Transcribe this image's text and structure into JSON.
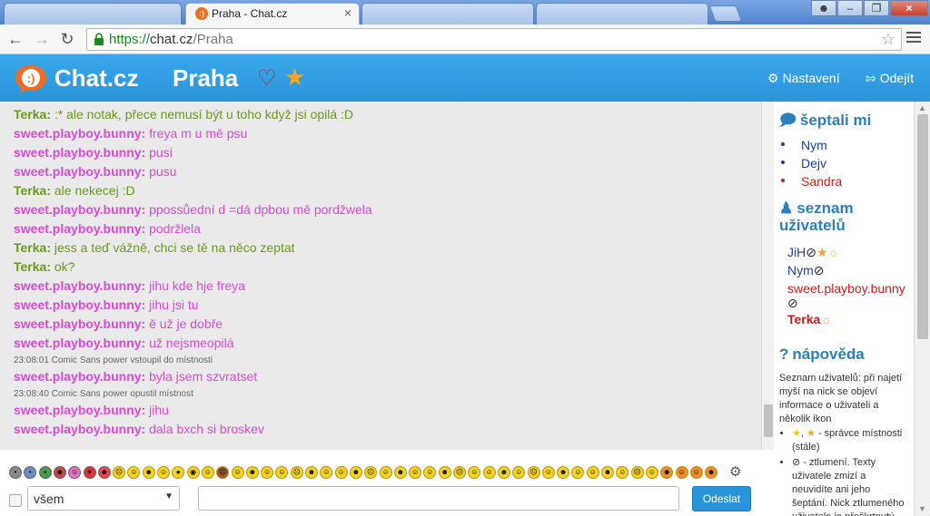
{
  "browser": {
    "active_tab_title": "Praha - Chat.cz",
    "url_scheme": "https://",
    "url_host": "chat.cz",
    "url_path": "/Praha"
  },
  "header": {
    "logo": "Chat.cz",
    "room": "Praha",
    "settings_label": "Nastavení",
    "logout_label": "Odejít"
  },
  "messages": [
    {
      "kind": "terka",
      "nick": "Terka:",
      "text": ":* ale notak, přece nemusí být u toho když jsi opilá :D"
    },
    {
      "kind": "bunny",
      "nick": "sweet.playboy.bunny:",
      "text": "freya m u mě psu"
    },
    {
      "kind": "bunny",
      "nick": "sweet.playboy.bunny:",
      "text": "pusi"
    },
    {
      "kind": "bunny",
      "nick": "sweet.playboy.bunny:",
      "text": "pusu"
    },
    {
      "kind": "terka",
      "nick": "Terka:",
      "text": "ale nekecej :D"
    },
    {
      "kind": "bunny",
      "nick": "sweet.playboy.bunny:",
      "text": "ppossůední d =dá dpbou mě pordžwela"
    },
    {
      "kind": "bunny",
      "nick": "sweet.playboy.bunny:",
      "text": "podržlela"
    },
    {
      "kind": "terka",
      "nick": "Terka:",
      "text": "jess a teď vážně, chci se tě na něco zeptat"
    },
    {
      "kind": "terka",
      "nick": "Terka:",
      "text": "ok?"
    },
    {
      "kind": "bunny",
      "nick": "sweet.playboy.bunny:",
      "text": "jihu kde hje freya"
    },
    {
      "kind": "bunny",
      "nick": "sweet.playboy.bunny:",
      "text": "jihu jsi tu"
    },
    {
      "kind": "bunny",
      "nick": "sweet.playboy.bunny:",
      "text": "ě už je dobře"
    },
    {
      "kind": "bunny",
      "nick": "sweet.playboy.bunny:",
      "text": "už nejsmeopilá"
    },
    {
      "kind": "system",
      "text": "23:08:01 Comic Sans power vstoupil do místnosti"
    },
    {
      "kind": "bunny",
      "nick": "sweet.playboy.bunny:",
      "text": "byla jsem szvratset"
    },
    {
      "kind": "system",
      "text": "23:08:40 Comic Sans power opustil místnost"
    },
    {
      "kind": "bunny",
      "nick": "sweet.playboy.bunny:",
      "text": "jihu"
    },
    {
      "kind": "bunny",
      "nick": "sweet.playboy.bunny:",
      "text": "dala bxch si broskev"
    }
  ],
  "sidebar": {
    "whispered_title": "šeptali mi",
    "whispered": [
      {
        "name": "Nym",
        "dot": "#1a3fa6"
      },
      {
        "name": "Dejv",
        "dot": "#1a3fa6"
      },
      {
        "name": "Sandra",
        "dot": "#d11a1a"
      }
    ],
    "users_title_1": "seznam",
    "users_title_2": "uživatelů",
    "users": [
      {
        "name": "JiH",
        "color": "#1a3fa6"
      },
      {
        "name": "Nym",
        "color": "#1a3fa6"
      },
      {
        "name": "sweet.playboy.bunny",
        "color": "#d11a1a"
      },
      {
        "name": "Terka",
        "color": "#d11a1a"
      }
    ],
    "help_title": "nápověda",
    "help_text": "Seznam uživatelů: při najetí myší na nick se objeví informace o uživateli a několik ikon",
    "help_items": [
      "- správce místnosti (stále)",
      "- ztlumení. Texty uživatele zmizí a neuvidíte ani jeho šeptání. Nick ztlumeného uživatele je přeškrtnutý"
    ]
  },
  "input": {
    "recipient": "všem",
    "send_label": "Odeslat"
  },
  "colors": {
    "header_blue": "#2a94db",
    "terka_green": "#6a9a1f",
    "bunny_pink": "#d94bd4"
  }
}
